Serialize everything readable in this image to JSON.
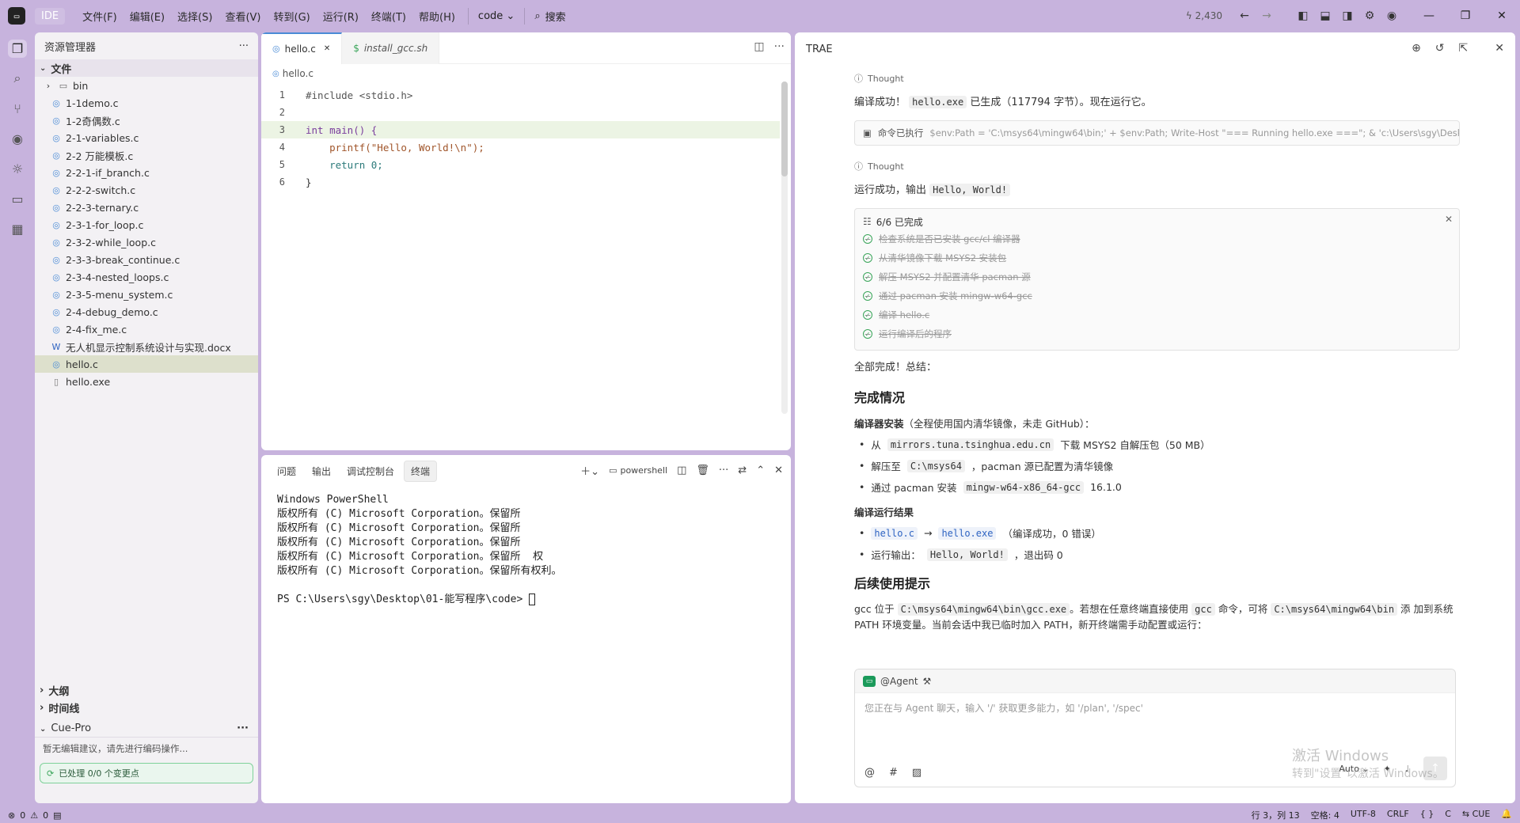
{
  "titlebar": {
    "app_name": "IDE",
    "menu": [
      "文件(F)",
      "编辑(E)",
      "选择(S)",
      "查看(V)",
      "转到(G)",
      "运行(R)",
      "终端(T)",
      "帮助(H)"
    ],
    "project": "code",
    "search": "搜索",
    "stat": "2,430"
  },
  "sidebar": {
    "title": "资源管理器",
    "section": "文件",
    "items": [
      {
        "label": "bin",
        "kind": "folder"
      },
      {
        "label": "1-1demo.c",
        "kind": "c"
      },
      {
        "label": "1-2奇偶数.c",
        "kind": "c"
      },
      {
        "label": "2-1-variables.c",
        "kind": "c"
      },
      {
        "label": "2-2 万能模板.c",
        "kind": "c"
      },
      {
        "label": "2-2-1-if_branch.c",
        "kind": "c"
      },
      {
        "label": "2-2-2-switch.c",
        "kind": "c"
      },
      {
        "label": "2-2-3-ternary.c",
        "kind": "c"
      },
      {
        "label": "2-3-1-for_loop.c",
        "kind": "c"
      },
      {
        "label": "2-3-2-while_loop.c",
        "kind": "c"
      },
      {
        "label": "2-3-3-break_continue.c",
        "kind": "c"
      },
      {
        "label": "2-3-4-nested_loops.c",
        "kind": "c"
      },
      {
        "label": "2-3-5-menu_system.c",
        "kind": "c"
      },
      {
        "label": "2-4-debug_demo.c",
        "kind": "c"
      },
      {
        "label": "2-4-fix_me.c",
        "kind": "c"
      },
      {
        "label": "无人机显示控制系统设计与实现.docx",
        "kind": "doc"
      },
      {
        "label": "hello.c",
        "kind": "c"
      },
      {
        "label": "hello.exe",
        "kind": "file"
      }
    ],
    "outline": "大纲",
    "timeline": "时间线",
    "cue_title": "Cue-Pro",
    "cue_hint": "暂无编辑建议，请先进行编码操作...",
    "cue_status": "已处理 0/0 个变更点"
  },
  "editor": {
    "tabs": [
      {
        "label": "hello.c",
        "active": true
      },
      {
        "label": "install_gcc.sh",
        "active": false
      }
    ],
    "breadcrumb": "hello.c",
    "lines": [
      {
        "n": "1",
        "text": "#include <stdio.h>"
      },
      {
        "n": "2",
        "text": ""
      },
      {
        "n": "3",
        "text": "int main() {"
      },
      {
        "n": "4",
        "text": "    printf(\"Hello, World!\\n\");"
      },
      {
        "n": "5",
        "text": "    return 0;"
      },
      {
        "n": "6",
        "text": "}"
      }
    ]
  },
  "panel": {
    "tabs": [
      "问题",
      "输出",
      "调试控制台",
      "终端"
    ],
    "shell": "powershell",
    "terminal": [
      "Windows PowerShell",
      "版权所有 (C) Microsoft Corporation。保留所",
      "版权所有 (C) Microsoft Corporation。保留所",
      "版权所有 (C) Microsoft Corporation。保留所",
      "版权所有 (C) Microsoft Corporation。保留所  权",
      "版权所有 (C) Microsoft Corporation。保留所有权利。",
      "",
      "PS C:\\Users\\sgy\\Desktop\\01-能写程序\\code> "
    ]
  },
  "chat": {
    "title": "TRAE",
    "thought_label": "Thought",
    "msg1_pre": "编译成功！",
    "msg1_code": "hello.exe",
    "msg1_post": "已生成（117794 字节）。现在运行它。",
    "cmd_label": "命令已执行",
    "cmd_text": "$env:Path = 'C:\\msys64\\mingw64\\bin;' + $env:Path; Write-Host \"=== Running hello.exe ===\"; & 'c:\\Users\\sgy\\Desktop\\0...",
    "msg2_pre": "运行成功，输出",
    "msg2_code": "Hello, World!",
    "todo_head": "6/6 已完成",
    "todos": [
      "检查系统是否已安装 gcc/cl 编译器",
      "从清华镜像下载 MSYS2 安装包",
      "解压 MSYS2 并配置清华 pacman 源",
      "通过 pacman 安装 mingw-w64-gcc",
      "编译 hello.c",
      "运行编译后的程序"
    ],
    "summary": "全部完成！总结：",
    "h_done": "完成情况",
    "compiler_title": "编译器安装",
    "compiler_note": "（全程使用国内清华镜像，未走 GitHub）：",
    "b1_pre": "从",
    "b1_code": "mirrors.tuna.tsinghua.edu.cn",
    "b1_post": "下载 MSYS2 自解压包（50 MB）",
    "b2_pre": "解压至",
    "b2_code": "C:\\msys64",
    "b2_post": "，pacman 源已配置为清华镜像",
    "b3_pre": "通过 pacman 安装",
    "b3_code": "mingw-w64-x86_64-gcc",
    "b3_post": "16.1.0",
    "run_title": "编译运行结果",
    "r1_code1": "hello.c",
    "r1_arrow": "→",
    "r1_code2": "hello.exe",
    "r1_post": "（编译成功，0 错误）",
    "r2_pre": "运行输出：",
    "r2_code": "Hello, World!",
    "r2_post": "，退出码 0",
    "h_next": "后续使用提示",
    "tip_1": "gcc 位于",
    "tip_code1": "C:\\msys64\\mingw64\\bin\\gcc.exe",
    "tip_2": "。若想在任意终端直接使用",
    "tip_code2": "gcc",
    "tip_3": "命令，可将",
    "tip_code3": "C:\\msys64\\mingw64\\bin",
    "tip_4": "添",
    "tip_5": "加到系统 PATH 环境变量。当前会话中我已临时加入 PATH，新开终端需手动配置或运行：",
    "agent_label": "@Agent",
    "input_placeholder": "您正在与 Agent 聊天，输入 '/' 获取更多能力，如 '/plan', '/spec'",
    "mode": "Auto",
    "watermark_1": "激活 Windows",
    "watermark_2": "转到\"设置\"以激活 Windows。"
  },
  "statusbar": {
    "errors": "0",
    "warnings": "0",
    "position": "行 3，列 13",
    "spaces": "空格: 4",
    "encoding": "UTF-8",
    "eol": "CRLF",
    "braces": "{ }",
    "lang": "C",
    "plugin": "CUE"
  }
}
